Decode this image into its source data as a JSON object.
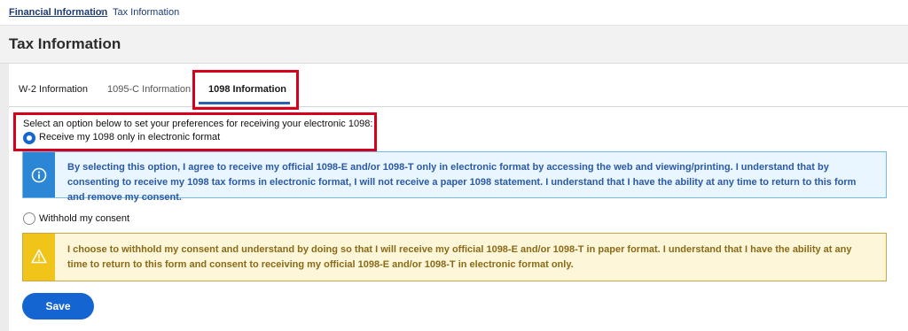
{
  "breadcrumb": {
    "parent": "Financial Information",
    "separator": "•",
    "current": "Tax Information"
  },
  "page": {
    "title": "Tax Information"
  },
  "tabs": [
    {
      "label": "W-2 Information",
      "active": false
    },
    {
      "label": "1095-C Information",
      "active": false
    },
    {
      "label": "1098 Information",
      "active": true
    }
  ],
  "preferences": {
    "instruction": "Select an option below to set your preferences for receiving your electronic 1098:",
    "options": [
      {
        "label": "Receive my 1098 only in electronic format",
        "selected": true
      },
      {
        "label": "Withhold my consent",
        "selected": false
      }
    ]
  },
  "alerts": {
    "info": {
      "icon": "info-icon",
      "text": "By selecting this option, I agree to receive my official 1098-E and/or 1098-T only in electronic format by accessing the web and viewing/printing. I understand that by consenting to receive my 1098 tax forms in electronic format, I will not receive a paper 1098 statement. I understand that I have the ability at any time to return to this form and remove my consent."
    },
    "warning": {
      "icon": "warning-icon",
      "text": "I choose to withhold my consent and understand by doing so that I will receive my official 1098-E and/or 1098-T in paper format. I understand that I have the ability at any time to return to this form and consent to receiving my official 1098-E and/or 1098-T in electronic format only."
    }
  },
  "actions": {
    "save_label": "Save"
  },
  "colors": {
    "accent": "#1464d2",
    "highlight_box": "#d6001c",
    "info_bar": "#2b87d6",
    "warning_bar": "#f0c419"
  }
}
